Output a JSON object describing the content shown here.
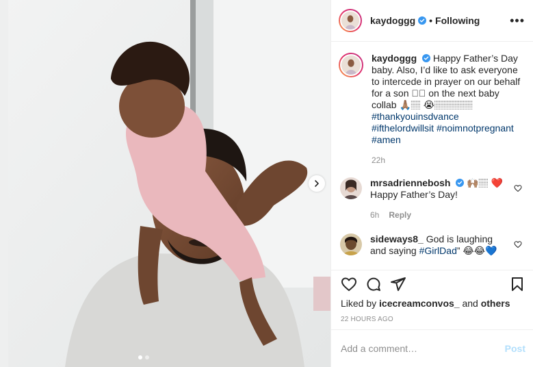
{
  "header": {
    "username": "kaydoggg",
    "separator": "•",
    "follow_status": "Following",
    "more_glyph": "•••"
  },
  "caption": {
    "username": "kaydoggg",
    "text": "Happy Father’s Day baby. Also, I’d like to ask everyone to intercede in prayer on our behalf for a son 🏽🏽 on the next baby collab 🙏🏽🏽 😭🏽🏽🏽🏽",
    "hashtags": [
      "#thankyouinsdvance",
      "#ifthelordwillsit",
      "#noimnotpregnant",
      "#amen"
    ],
    "time": "22h"
  },
  "comments": [
    {
      "username": "mrsadriennebosh",
      "emojis": "🙌🏽🏽 ❤️",
      "text": "Happy Father’s Day!",
      "time": "6h",
      "reply_label": "Reply"
    },
    {
      "username": "sideways8_",
      "text": "God is laughing and saying ",
      "hashtag": "#GirlDad",
      "text_end": "” 😂😂💙"
    }
  ],
  "likes": {
    "prefix": "Liked by ",
    "user": "icecreamconvos_",
    "middle": " and ",
    "suffix": "others"
  },
  "timestamp": "22 HOURS AGO",
  "add_comment": {
    "placeholder": "Add a comment…",
    "post_label": "Post"
  },
  "carousel": {
    "current": 1,
    "total": 2
  },
  "colors": {
    "verified": "#3897f0",
    "hashtag": "#00376b",
    "muted": "#8e8e8e",
    "post_disabled": "#b2dffc",
    "heart_red": "#ed4956"
  },
  "icons": [
    "more-icon",
    "verified-icon",
    "heart-icon",
    "comment-icon",
    "share-icon",
    "save-icon",
    "next-arrow-icon"
  ]
}
